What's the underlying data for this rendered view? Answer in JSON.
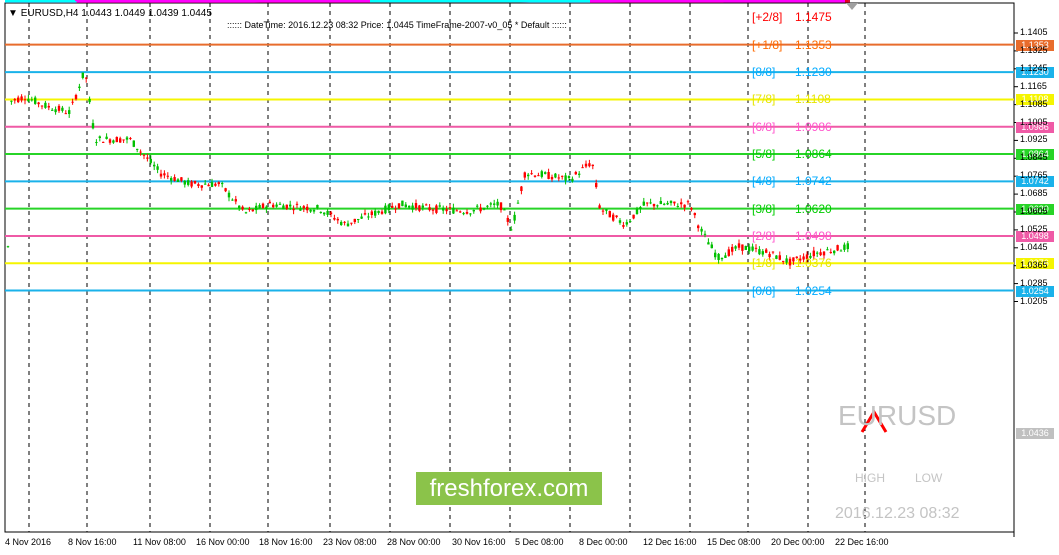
{
  "header": {
    "symbol_line": "EURUSD,H4  1.0443 1.0449 1.0439 1.0445",
    "info_line": ":::::: DateTime: 2016.12.23 08:32    Price: 1.0445    TimeFrame-2007-v0_05    *   Default   ::::::"
  },
  "murrey_levels": [
    {
      "label": "[+2/8]",
      "value": "1.1475",
      "color": "#ff0000",
      "line": false
    },
    {
      "label": "[+1/8]",
      "value": "1.1353",
      "color": "#ff6a00",
      "line": true,
      "line_color": "#e86c2c"
    },
    {
      "label": "[8/8]",
      "value": "1.1230",
      "color": "#00aaff",
      "line": true,
      "line_color": "#1ab2ea"
    },
    {
      "label": "[7/8]",
      "value": "1.1108",
      "color": "#e6e600",
      "line": true,
      "line_color": "#f5f500"
    },
    {
      "label": "[6/8]",
      "value": "1.0986",
      "color": "#ff55cc",
      "line": true,
      "line_color": "#ef5aa6"
    },
    {
      "label": "[5/8]",
      "value": "1.0864",
      "color": "#00cc00",
      "line": true,
      "line_color": "#27d427"
    },
    {
      "label": "[4/8]",
      "value": "1.0742",
      "color": "#00aaff",
      "line": true,
      "line_color": "#1ab2ea"
    },
    {
      "label": "[3/8]",
      "value": "1.0620",
      "color": "#00cc00",
      "line": true,
      "line_color": "#27d427"
    },
    {
      "label": "[2/8]",
      "value": "1.0498",
      "color": "#ff55cc",
      "line": true,
      "line_color": "#ef5aa6"
    },
    {
      "label": "[1/8]",
      "value": "1.0376",
      "color": "#e6e600",
      "line": true,
      "line_color": "#f5f500"
    },
    {
      "label": "[0/8]",
      "value": "1.0254",
      "color": "#00aaff",
      "line": true,
      "line_color": "#1ab2ea"
    }
  ],
  "price_axis": {
    "ticks": [
      "1.1405",
      "1.1325",
      "1.1245",
      "1.1165",
      "1.1085",
      "1.1005",
      "1.0925",
      "1.0845",
      "1.0765",
      "1.0685",
      "1.0605",
      "1.0525",
      "1.0445",
      "1.0365",
      "1.0285",
      "1.0205"
    ],
    "current_price": "1.0436",
    "current_color": "#c0c0c0"
  },
  "time_axis": [
    "4 Nov 2016",
    "8 Nov 16:00",
    "11 Nov 08:00",
    "16 Nov 00:00",
    "18 Nov 16:00",
    "23 Nov 08:00",
    "28 Nov 00:00",
    "30 Nov 16:00",
    "5 Dec 08:00",
    "8 Dec 00:00",
    "12 Dec 16:00",
    "15 Dec 08:00",
    "20 Dec 00:00",
    "22 Dec 16:00"
  ],
  "watermark": {
    "logo": "freshforex.com",
    "symbol": "EURUSD",
    "high_label": "HIGH",
    "low_label": "LOW",
    "datetime": "2016.12.23 08:32"
  },
  "colors": {
    "bull_candle": "#00c000",
    "bear_candle": "#ff0000",
    "trend_red": "#e8001c",
    "trend_magenta": "#ff00ff",
    "trend_cyan": "#00ffff",
    "dark_red": "#d0103a"
  }
}
